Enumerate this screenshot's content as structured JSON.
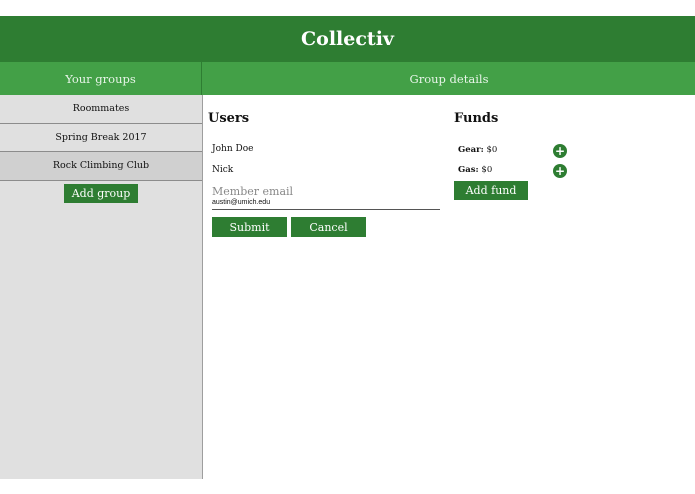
{
  "app": {
    "title": "Collectiv"
  },
  "subheader": {
    "groups_label": "Your groups",
    "details_label": "Group details"
  },
  "sidebar": {
    "groups": [
      {
        "label": "Roommates"
      },
      {
        "label": "Spring Break 2017"
      },
      {
        "label": "Rock Climbing Club"
      }
    ],
    "add_group_label": "Add group"
  },
  "users": {
    "title": "Users",
    "list": [
      "John Doe",
      "Nick"
    ],
    "email_placeholder": "Member email",
    "email_value": "austin@umich.edu",
    "submit_label": "Submit",
    "cancel_label": "Cancel"
  },
  "funds": {
    "title": "Funds",
    "list": [
      {
        "name": "Gear:",
        "amount": "$0"
      },
      {
        "name": "Gas:",
        "amount": "$0"
      }
    ],
    "add_label": "Add fund",
    "add_icon": "plus-icon"
  },
  "colors": {
    "primary": "#2e7d32",
    "secondary": "#43a047",
    "sidebar_bg": "#e0e0e0"
  }
}
